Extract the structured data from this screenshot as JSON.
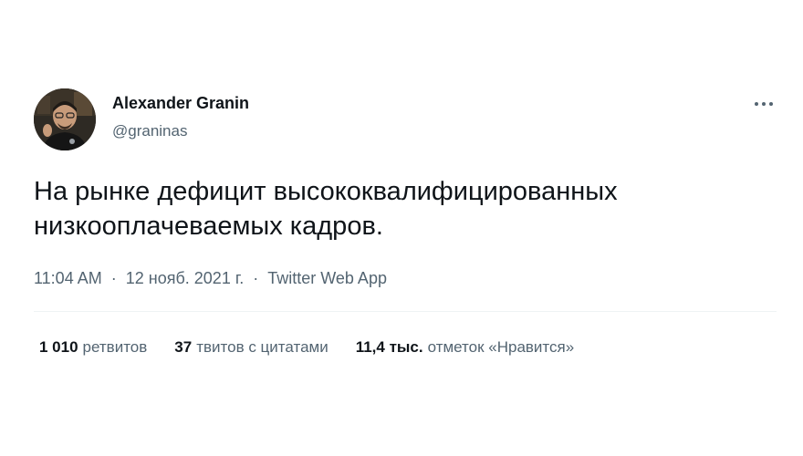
{
  "author": {
    "name": "Alexander Granin",
    "handle": "@graninas"
  },
  "tweet": {
    "line1": "На рынке дефицит высококвалифицированных",
    "line2": "низкооплачеваемых кадров."
  },
  "meta": {
    "time": "11:04 AM",
    "separator1": "·",
    "date": "12 нояб. 2021 г.",
    "separator2": "·",
    "source": "Twitter Web App"
  },
  "stats": {
    "retweets_count": "1 010",
    "retweets_label": "ретвитов",
    "quotes_count": "37",
    "quotes_label": "твитов с цитатами",
    "likes_count": "11,4 тыс.",
    "likes_label": "отметок «Нравится»"
  },
  "icons": {
    "more": "more-horizontal-icon"
  },
  "colors": {
    "text_primary": "#0f1419",
    "text_secondary": "#536471",
    "divider": "#eff3f4",
    "background": "#ffffff"
  }
}
